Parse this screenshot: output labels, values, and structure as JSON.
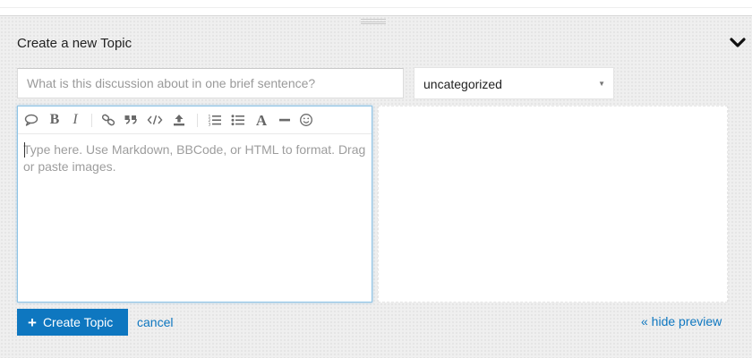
{
  "composer": {
    "title": "Create a new Topic",
    "collapse_icon": "chevron-down-icon",
    "title_input": {
      "value": "",
      "placeholder": "What is this discussion about in one brief sentence?"
    },
    "category": {
      "selected": "uncategorized"
    },
    "editor": {
      "placeholder": "Type here. Use Markdown, BBCode, or HTML to format. Drag or paste images.",
      "toolbar": [
        "speech-bubble-icon",
        "bold-icon",
        "italic-icon",
        "link-icon",
        "quote-icon",
        "code-icon",
        "upload-icon",
        "numbered-list-icon",
        "bulleted-list-icon",
        "heading-icon",
        "horizontal-rule-icon",
        "emoji-icon"
      ]
    },
    "actions": {
      "create_label": "Create Topic",
      "cancel_label": "cancel",
      "hide_preview_label": "« hide preview"
    }
  },
  "colors": {
    "primary": "#0e77c0",
    "editor_focus_border": "#8fc4e6",
    "background": "#efefef"
  }
}
